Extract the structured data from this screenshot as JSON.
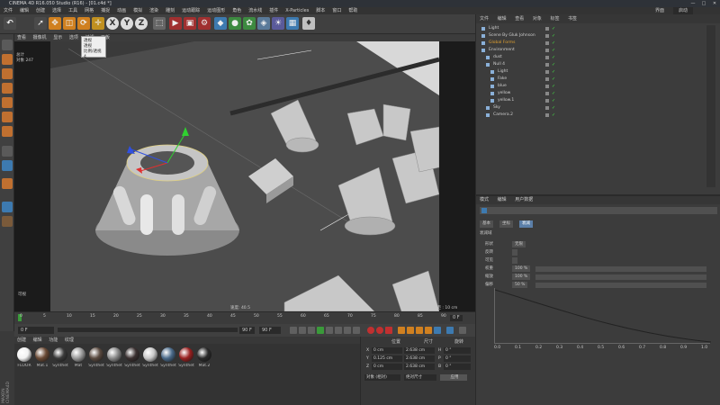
{
  "app": {
    "title": "CINEMA 4D R16.050 Studio (R16) - [01.c4d *]",
    "window_controls": [
      "—",
      "□",
      "✕"
    ]
  },
  "menubar": {
    "items": [
      "文件",
      "编辑",
      "创建",
      "选择",
      "工具",
      "网格",
      "捕捉",
      "动画",
      "模拟",
      "渲染",
      "雕刻",
      "运动跟踪",
      "运动图形",
      "角色",
      "流水线",
      "插件",
      "X-Particles",
      "脚本",
      "窗口",
      "帮助"
    ],
    "layout_label": "界面",
    "layout_value": "启动"
  },
  "toolbar": {
    "tool_letters": [
      "X",
      "Y",
      "Z"
    ]
  },
  "viewport": {
    "menu": [
      "查看",
      "摄像机",
      "显示",
      "选项",
      "过滤",
      "面板"
    ],
    "dropdown_items": [
      "透视",
      "透视",
      "比例/透视4"
    ],
    "hud": {
      "label_line1": "总计",
      "label_line2": "对象",
      "count": "247"
    },
    "bottom_left_label": "可视",
    "speed_label": "速度: 40.5",
    "grid_label": "网格间距 : 10 cm"
  },
  "timeline": {
    "ticks": [
      "0",
      "5",
      "10",
      "15",
      "20",
      "25",
      "30",
      "35",
      "40",
      "45",
      "50",
      "55",
      "60",
      "65",
      "70",
      "75",
      "80",
      "85",
      "90"
    ],
    "end_frame": "0 F"
  },
  "transport": {
    "current": "0 F",
    "start": "0 F",
    "end": "90 F",
    "end2": "90 F"
  },
  "materials": {
    "menu": [
      "创建",
      "编辑",
      "功能",
      "纹理"
    ],
    "items": [
      {
        "name": "FLOOR",
        "color": "#f2f2f2"
      },
      {
        "name": "Mat.1",
        "color": "#6a4a35"
      },
      {
        "name": "Synthet",
        "color": "#3a3a3a"
      },
      {
        "name": "Mat",
        "color": "#9a9a9a"
      },
      {
        "name": "Synthet",
        "color": "#5a4a40"
      },
      {
        "name": "Synthet",
        "color": "#8a8a8a"
      },
      {
        "name": "Synthet",
        "color": "#3a3030"
      },
      {
        "name": "Synthet",
        "color": "#c8c8c8"
      },
      {
        "name": "Synthet",
        "color": "#4a6a8a"
      },
      {
        "name": "Synthet",
        "color": "#9a2020"
      },
      {
        "name": "Mat.2",
        "color": "#2a2a2a"
      }
    ],
    "brand_line1": "MAXON",
    "brand_line2": "CINEMA4D"
  },
  "coords": {
    "headers": [
      "位置",
      "尺寸",
      "旋转"
    ],
    "rows": [
      {
        "axis": "X",
        "pos": "0 cm",
        "size": "2.638 cm",
        "rot_axis": "H",
        "rot": "0 °"
      },
      {
        "axis": "Y",
        "pos": "0.125 cm",
        "size": "2.638 cm",
        "rot_axis": "P",
        "rot": "0 °"
      },
      {
        "axis": "Z",
        "pos": "0 cm",
        "size": "2.638 cm",
        "rot_axis": "B",
        "rot": "0 °"
      }
    ],
    "mode_object": "对象 (相对)",
    "mode_size": "绝对尺寸",
    "apply": "应用"
  },
  "object_manager": {
    "menu": [
      "文件",
      "编辑",
      "查看",
      "对象",
      "标签",
      "书签"
    ],
    "objects": [
      {
        "name": "Light",
        "indent": 0,
        "color": "#cfcfcf"
      },
      {
        "name": "Scene By Gluk Johnson",
        "indent": 0,
        "color": "#cfcfcf"
      },
      {
        "name": "Global Forms",
        "indent": 0,
        "color": "#e0a030"
      },
      {
        "name": "Environment",
        "indent": 0,
        "color": "#cfcfcf"
      },
      {
        "name": "dust",
        "indent": 1,
        "color": "#cfcfcf"
      },
      {
        "name": "Null 4",
        "indent": 1,
        "color": "#cfcfcf"
      },
      {
        "name": "Light",
        "indent": 2,
        "color": "#cfcfcf"
      },
      {
        "name": "Fake",
        "indent": 2,
        "color": "#cfcfcf"
      },
      {
        "name": "blue",
        "indent": 2,
        "color": "#cfcfcf"
      },
      {
        "name": "yellow",
        "indent": 2,
        "color": "#cfcfcf"
      },
      {
        "name": "yellow.1",
        "indent": 2,
        "color": "#cfcfcf"
      },
      {
        "name": "Sky",
        "indent": 1,
        "color": "#cfcfcf"
      },
      {
        "name": "Camera.2",
        "indent": 1,
        "color": "#cfcfcf"
      }
    ]
  },
  "attribute_manager": {
    "menu": [
      "模式",
      "编辑",
      "用户数据"
    ],
    "tabs": [
      "基本",
      "坐标",
      "衰减"
    ],
    "active_tab": "衰减",
    "section": "衰减域",
    "fields": [
      {
        "label": "形状",
        "value": "无限"
      },
      {
        "label": "反转",
        "value": ""
      },
      {
        "label": "可见",
        "value": ""
      },
      {
        "label": "权重",
        "value": "100 %"
      },
      {
        "label": "缩放",
        "value": "100 %"
      },
      {
        "label": "偏移",
        "value": "50 %"
      }
    ],
    "graph_ticks": [
      "0.0",
      "0.1",
      "0.2",
      "0.3",
      "0.4",
      "0.5",
      "0.6",
      "0.7",
      "0.8",
      "0.9",
      "1.0"
    ]
  }
}
